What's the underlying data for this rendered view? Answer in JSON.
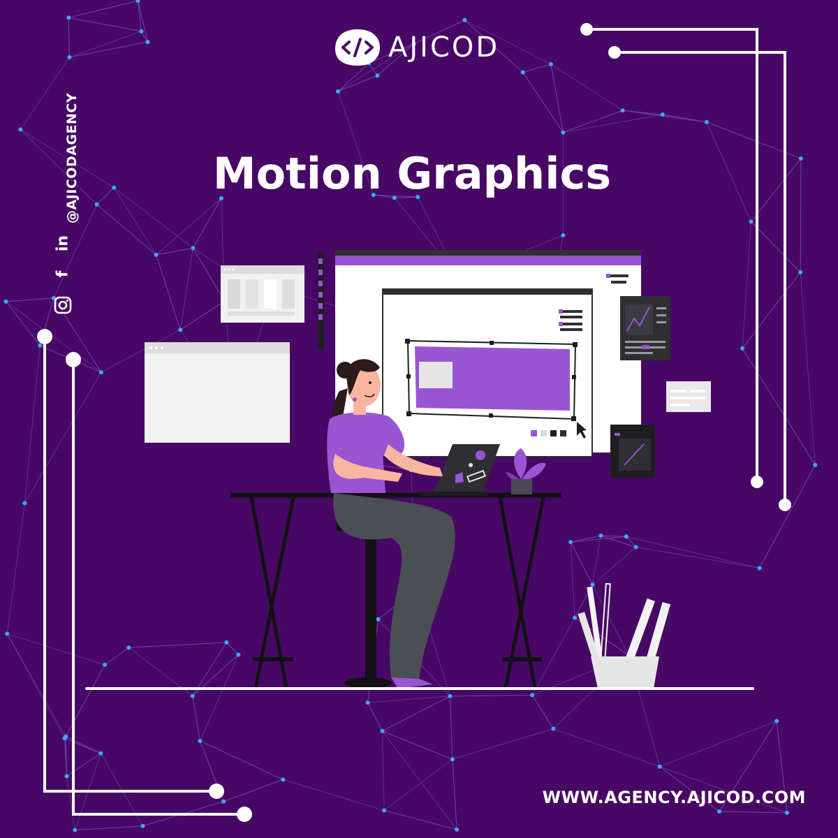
{
  "brand": {
    "name": "AJICOD",
    "logo_icon": "code-brackets-icon"
  },
  "headline": "Motion Graphics",
  "social": {
    "handle": "@AJICODAGENCY",
    "icons": [
      "instagram-icon",
      "facebook-icon",
      "linkedin-icon"
    ]
  },
  "website": "WWW.AGENCY.AJICOD.COM",
  "colors": {
    "background": "#470865",
    "accent": "#9a55d2",
    "network_node": "#3aa9ff",
    "white": "#ffffff",
    "dark": "#2e2e33"
  }
}
